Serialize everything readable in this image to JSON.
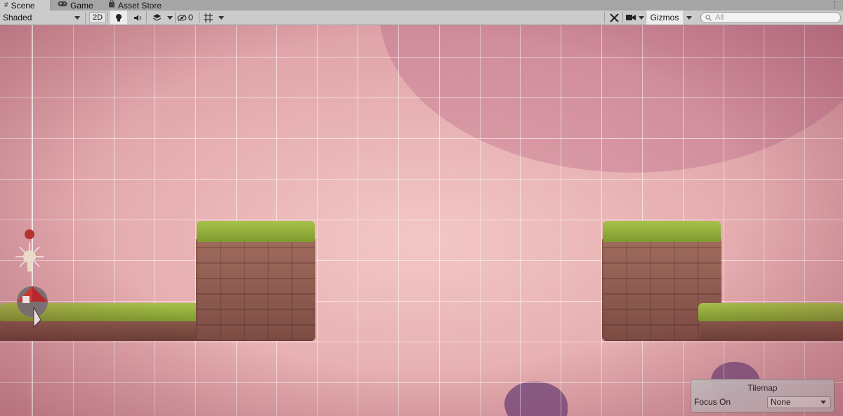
{
  "tabs": [
    {
      "label": "Scene",
      "icon": "grid-icon"
    },
    {
      "label": "Game",
      "icon": "gamepad-icon"
    },
    {
      "label": "Asset Store",
      "icon": "bag-icon"
    }
  ],
  "toolbar": {
    "draw_mode": "Shaded",
    "mode_2d": "2D",
    "hidden_count": "0",
    "gizmos_label": "Gizmos",
    "search_placeholder": "All"
  },
  "tilemap_overlay": {
    "title": "Tilemap",
    "focus_label": "Focus On",
    "focus_value": "None"
  },
  "colors": {
    "sky": "#e9b6b7",
    "grass": "#8fae3b",
    "stone": "#8e5c50",
    "panel": "#cbcbcb"
  }
}
